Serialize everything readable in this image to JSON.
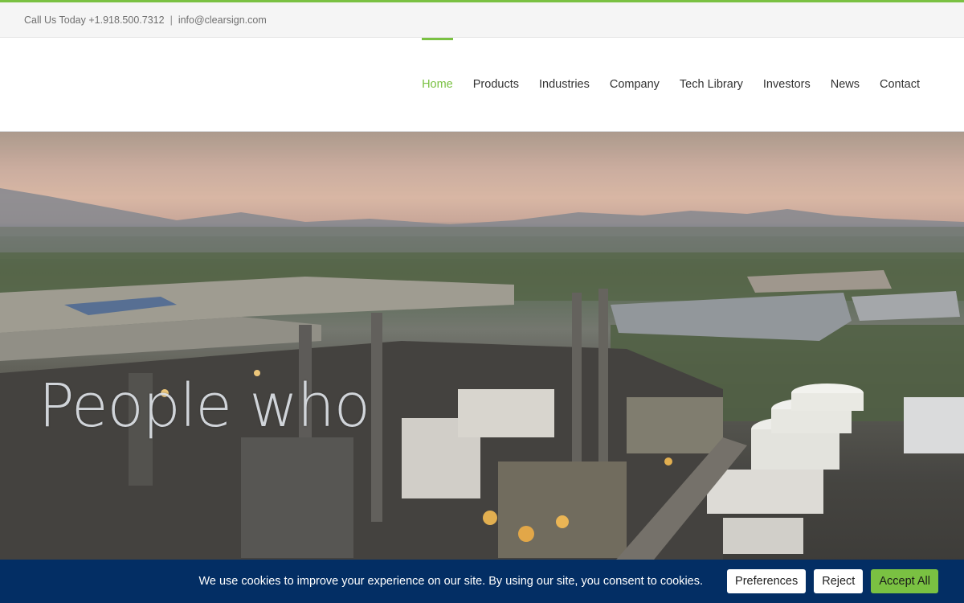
{
  "topbar": {
    "phone": "Call Us Today +1.918.500.7312",
    "separator": "|",
    "email": "info@clearsign.com"
  },
  "nav": {
    "items": [
      {
        "label": "Home",
        "active": true
      },
      {
        "label": "Products"
      },
      {
        "label": "Industries"
      },
      {
        "label": "Company"
      },
      {
        "label": "Tech Library"
      },
      {
        "label": "Investors"
      },
      {
        "label": "News"
      },
      {
        "label": "Contact"
      }
    ]
  },
  "hero": {
    "headline": "People who"
  },
  "cookie": {
    "message": "We use cookies to improve your experience on our site. By using our site, you consent to cookies.",
    "preferences_label": "Preferences",
    "reject_label": "Reject",
    "accept_label": "Accept All"
  },
  "colors": {
    "accent": "#7ac142",
    "cookie_bar": "#032e64",
    "nav_text": "#333333"
  }
}
